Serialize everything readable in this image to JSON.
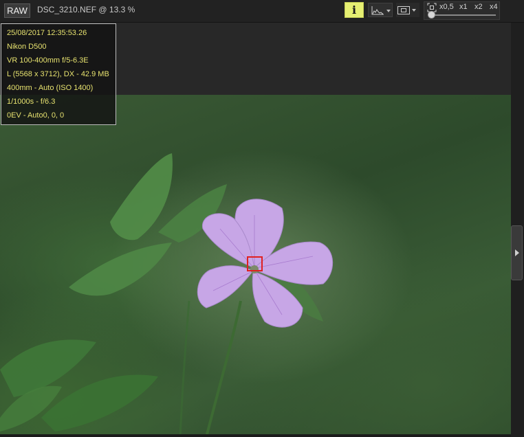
{
  "toolbar": {
    "raw_badge": "RAW",
    "file_title": "DSC_3210.NEF @ 13.3 %",
    "info_button_label": "i",
    "zoom_levels": [
      "x0,5",
      "x1",
      "x2",
      "x4"
    ],
    "info_button_color": "#e6ef72"
  },
  "shot_info": {
    "lines": [
      "25/08/2017 12:35:53.26",
      "Nikon D500",
      "VR 100-400mm f/5-6.3E",
      "L (5568 x 3712), DX - 42.9 MB",
      "400mm - Auto (ISO 1400)",
      "1/1000s - f/6.3",
      "0EV - Auto0, 0, 0"
    ],
    "text_color": "#e7e26f"
  },
  "icons": {
    "histogram": "histogram-icon",
    "frame": "frame-icon",
    "zoom_fit": "zoom-fit-icon",
    "panel_toggle": "chevron-right-icon"
  },
  "focus_point_color": "#e02020"
}
